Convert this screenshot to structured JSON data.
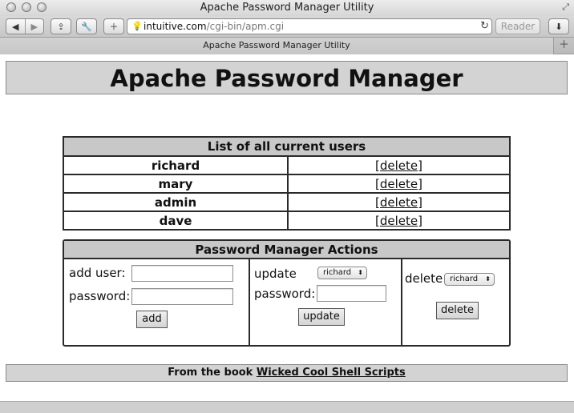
{
  "window": {
    "title": "Apache Password Manager Utility"
  },
  "toolbar": {
    "url_host": "intuitive.com",
    "url_path": "/cgi-bin/apm.cgi",
    "reader_label": "Reader"
  },
  "tab": {
    "title": "Apache Password Manager Utility"
  },
  "page": {
    "heading": "Apache Password Manager",
    "users_table": {
      "header": "List of all current users",
      "rows": [
        {
          "name": "richard",
          "action": "[delete]"
        },
        {
          "name": "mary",
          "action": "[delete]"
        },
        {
          "name": "admin",
          "action": "[delete]"
        },
        {
          "name": "dave",
          "action": "[delete]"
        }
      ]
    },
    "actions": {
      "title": "Password Manager Actions",
      "add": {
        "user_label": "add user:",
        "password_label": "password:",
        "button_label": "add"
      },
      "update": {
        "user_label": "update",
        "selected_user": "richard",
        "password_label": "password:",
        "button_label": "update"
      },
      "delete": {
        "label": "delete",
        "selected_user": "richard",
        "button_label": "delete"
      }
    },
    "footer": {
      "prefix": "From the book ",
      "book_title": "Wicked Cool Shell Scripts"
    }
  }
}
